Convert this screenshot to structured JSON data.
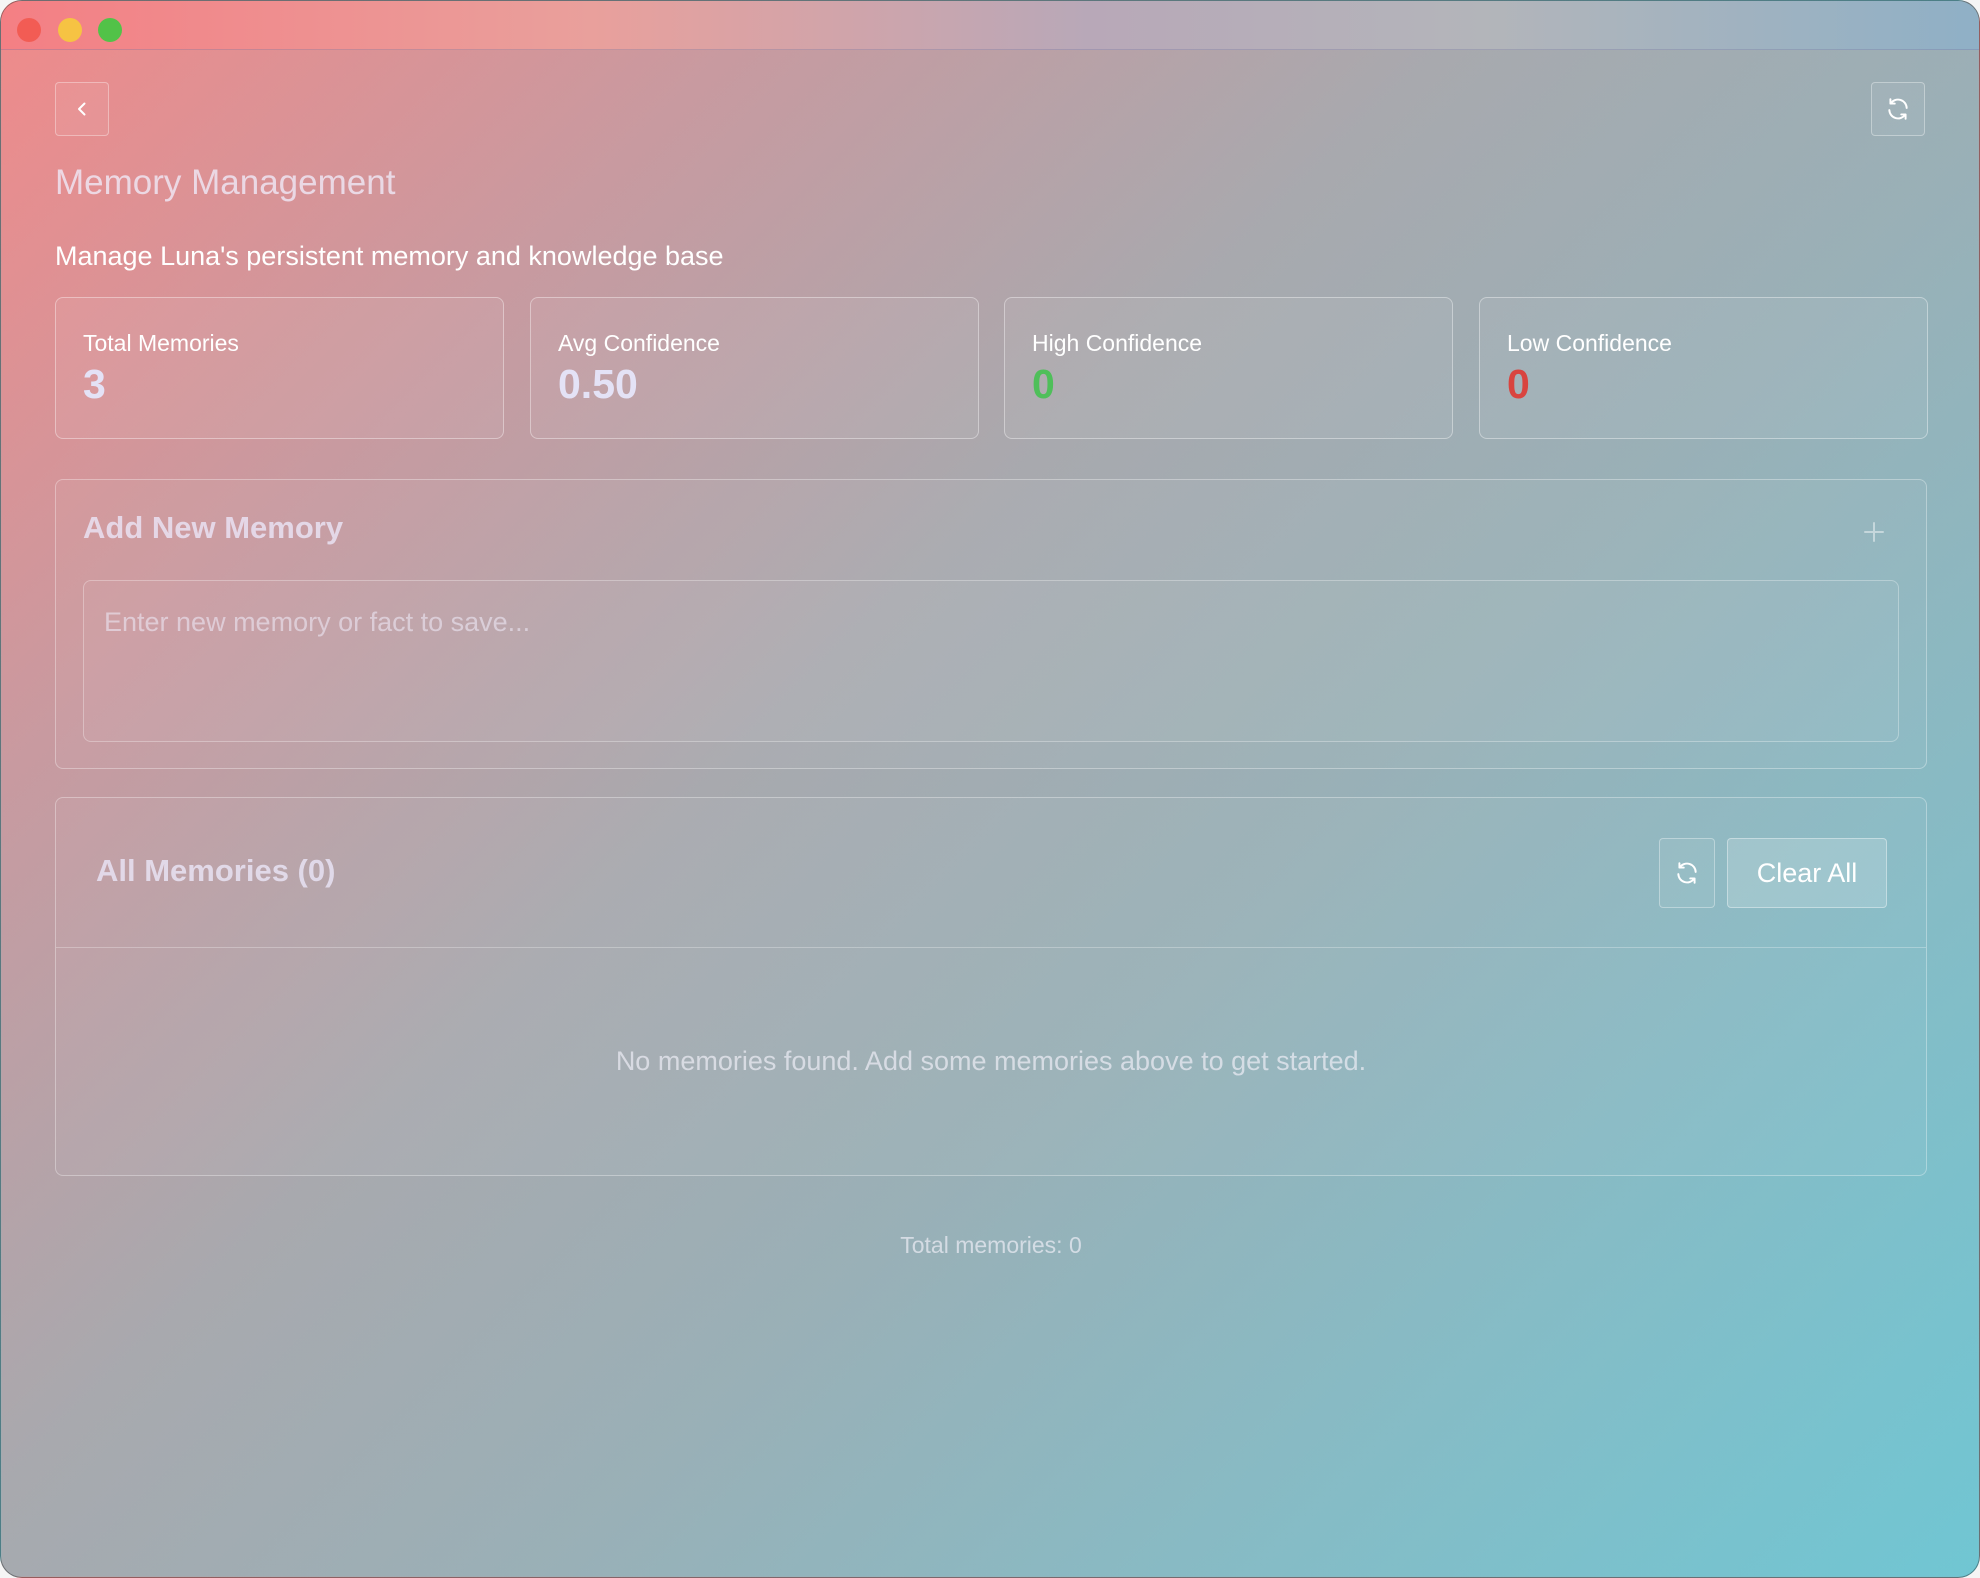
{
  "header": {
    "back_icon": "chevron-left-icon",
    "refresh_icon": "refresh-icon"
  },
  "page": {
    "title": "Memory Management",
    "subtitle": "Manage Luna's persistent memory and knowledge base"
  },
  "stats": [
    {
      "label": "Total Memories",
      "value": "3",
      "color": "#e4e2f6"
    },
    {
      "label": "Avg Confidence",
      "value": "0.50",
      "color": "#e4e2f6"
    },
    {
      "label": "High Confidence",
      "value": "0",
      "color": "#4fbf5a"
    },
    {
      "label": "Low Confidence",
      "value": "0",
      "color": "#d9443f"
    }
  ],
  "add_memory": {
    "title": "Add New Memory",
    "add_icon": "plus-icon",
    "placeholder": "Enter new memory or fact to save..."
  },
  "all_memories": {
    "title": "All Memories (0)",
    "refresh_icon": "refresh-icon",
    "clear_label": "Clear All",
    "empty_message": "No memories found. Add some memories above to get started."
  },
  "footer": {
    "total_text": "Total memories: 0"
  }
}
